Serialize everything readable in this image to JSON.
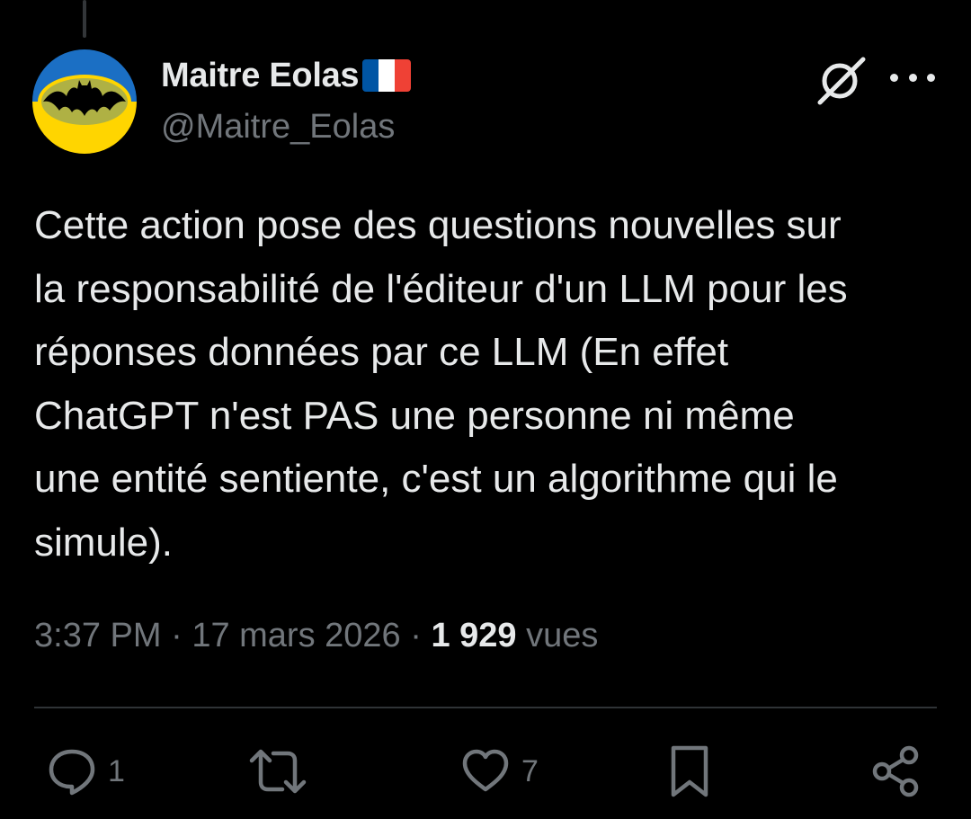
{
  "author": {
    "display_name": "Maitre Eolas",
    "handle": "@Maitre_Eolas",
    "flag": "france-flag",
    "avatar": "batman-signal-ukraine-colors-avatar"
  },
  "header_actions": {
    "grok_icon": "grok-icon",
    "more_icon": "more-horizontal-icon"
  },
  "tweet": {
    "text": "Cette action pose des questions nouvelles sur\nla responsabilité de l'éditeur d'un LLM pour les\nréponses données par ce LLM (En effet\nChatGPT n'est PAS une personne ni même\nune entité sentiente, c'est un algorithme qui le\nsimule)."
  },
  "meta": {
    "time": "3:37 PM",
    "separator1": " · ",
    "date": "17 mars 2026",
    "separator2": " · ",
    "views_count": "1 929",
    "views_label": " vues"
  },
  "actions": {
    "reply": {
      "icon": "reply-icon",
      "count": "1"
    },
    "retweet": {
      "icon": "retweet-icon",
      "count": ""
    },
    "like": {
      "icon": "heart-icon",
      "count": "7"
    },
    "bookmark": {
      "icon": "bookmark-icon"
    },
    "share": {
      "icon": "share-icon"
    }
  },
  "colors": {
    "background": "#000000",
    "text_primary": "#e7e9ea",
    "text_secondary": "#71767b",
    "divider": "#2f3336",
    "flag_blue": "#0055a4",
    "flag_white": "#ffffff",
    "flag_red": "#ef4135",
    "avatar_blue": "#1b6fc4",
    "avatar_yellow": "#ffd500"
  }
}
